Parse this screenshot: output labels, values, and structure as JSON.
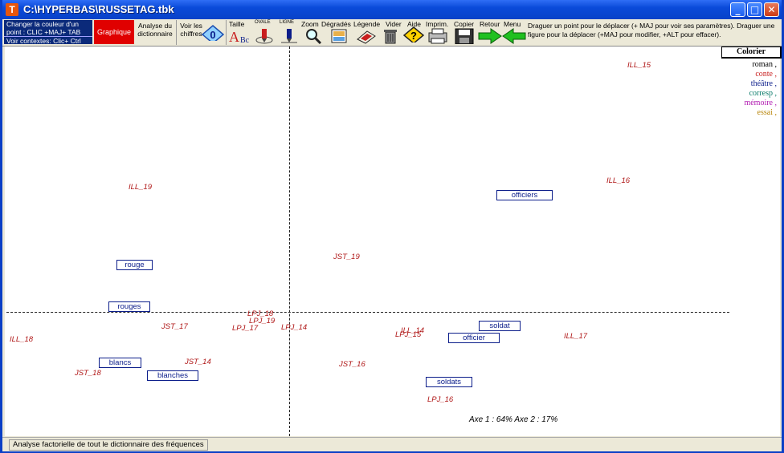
{
  "window": {
    "title": "C:\\HYPERBAS\\RUSSETAG.tbk",
    "app_icon": "T"
  },
  "toolbar": {
    "left_info": {
      "line1": "Changer la couleur d'un",
      "line2": "point : CLIC +MAJ+ TAB",
      "line3": "Voir contextes: Clic+ Ctrl"
    },
    "graphique": "Graphique",
    "analyse": {
      "line1": "Analyse du",
      "line2": "dictionnaire"
    },
    "voir": {
      "line1": "Voir les",
      "line2": "chiffres"
    },
    "tools": [
      "Taille",
      "OVALE",
      "LIGNE",
      "Zoom",
      "Dégradés",
      "Légende",
      "Vider",
      "Aide",
      "Imprim.",
      "Copier",
      "Retour",
      "Menu"
    ],
    "help": "Draguer un point pour le déplacer (+ MAJ  pour voir ses paramètres). Draguer une figure pour la déplacer (+MAJ pour modifier, +ALT pour effacer)."
  },
  "plot": {
    "points": [
      {
        "label": "ILL_15"
      },
      {
        "label": "ILL_16"
      },
      {
        "label": "ILL_19"
      },
      {
        "label": "JST_19"
      },
      {
        "label": "LPJ_18"
      },
      {
        "label": "LPJ_19"
      },
      {
        "label": "LPJ_17"
      },
      {
        "label": "LPJ_14"
      },
      {
        "label": "JST_17"
      },
      {
        "label": "ILL_18"
      },
      {
        "label": "JST_14"
      },
      {
        "label": "JST_18"
      },
      {
        "label": "JST_16"
      },
      {
        "label": "ILL_14"
      },
      {
        "label": "LPJ_15"
      },
      {
        "label": "ILL_17"
      },
      {
        "label": "LPJ_16"
      }
    ],
    "words": [
      {
        "label": "officiers"
      },
      {
        "label": "rouge"
      },
      {
        "label": "rouges"
      },
      {
        "label": "soldat"
      },
      {
        "label": "officier"
      },
      {
        "label": "blancs"
      },
      {
        "label": "blanches"
      },
      {
        "label": "soldats"
      }
    ],
    "axis_info": "Axe 1 :  64%    Axe 2 :  17%"
  },
  "colorier": "Colorier",
  "legend": [
    {
      "label": "roman",
      "color": "#000000"
    },
    {
      "label": "conte",
      "color": "#c81e1e"
    },
    {
      "label": "théâtre",
      "color": "#0b1d8a"
    },
    {
      "label": "corresp",
      "color": "#0a7a6a"
    },
    {
      "label": "mémoire",
      "color": "#b01ab0"
    },
    {
      "label": "essai",
      "color": "#b8860b"
    }
  ],
  "status": "Analyse factorielle de tout le dictionnaire des fréquences"
}
